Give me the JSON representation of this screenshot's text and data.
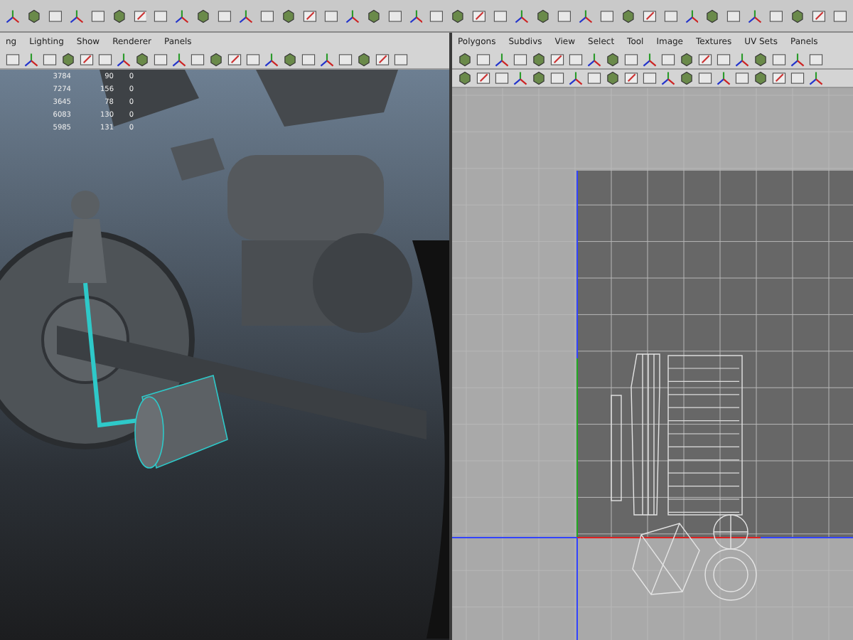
{
  "viewport": {
    "menu": [
      "ng",
      "Lighting",
      "Show",
      "Renderer",
      "Panels"
    ],
    "stats": [
      {
        "column_1": "3784",
        "column_2": "90",
        "column_3": "0"
      },
      {
        "column_1": "7274",
        "column_2": "156",
        "column_3": "0"
      },
      {
        "column_1": "3645",
        "column_2": "78",
        "column_3": "0"
      },
      {
        "column_1": "6083",
        "column_2": "130",
        "column_3": "0"
      },
      {
        "column_1": "5985",
        "column_2": "131",
        "column_3": "0"
      }
    ]
  },
  "uv_editor": {
    "menu": [
      "Polygons",
      "Subdivs",
      "View",
      "Select",
      "Tool",
      "Image",
      "Textures",
      "UV Sets",
      "Panels"
    ]
  }
}
